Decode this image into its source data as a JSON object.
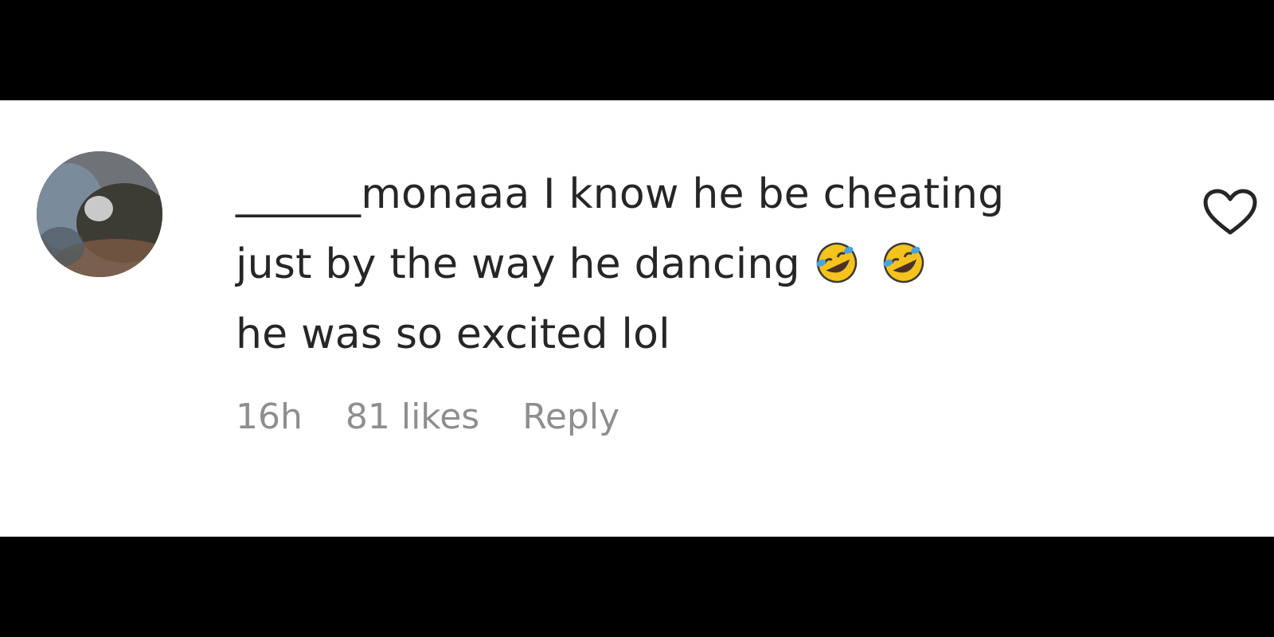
{
  "comment": {
    "username": "______monaaa",
    "text_line1": " I know he be cheating",
    "text_line2": "just by the way he dancing",
    "text_line3": "he was so excited lol",
    "emojis": [
      "rolling-on-floor-laughing-emoji",
      "rolling-on-floor-laughing-emoji"
    ],
    "time": "16h",
    "likes": "81 likes",
    "reply_label": "Reply"
  },
  "colors": {
    "text": "#262626",
    "meta": "#8e8e8e",
    "background": "#ffffff",
    "letterbox": "#000000"
  },
  "icons": {
    "like": "heart-outline-icon",
    "avatar": "user-avatar"
  }
}
